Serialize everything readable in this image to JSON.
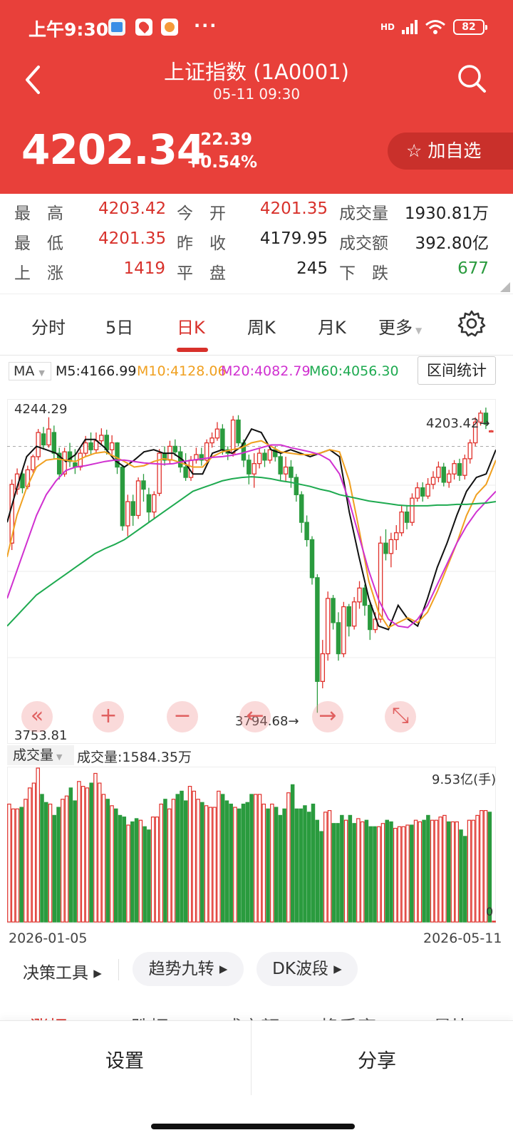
{
  "status": {
    "time": "上午9:30",
    "dots": "···",
    "net": "HD",
    "battery": "82"
  },
  "nav": {
    "title": "上证指数 (1A0001)",
    "subtitle": "05-11 09:30"
  },
  "quote": {
    "price": "4202.34",
    "change": "+22.39",
    "change_pct": "+0.54%",
    "fav_label": "☆ 加自选"
  },
  "stats": [
    {
      "label": "最　高",
      "value": "4203.42"
    },
    {
      "label": "今　开",
      "value": "4201.35"
    },
    {
      "label": "成交量",
      "value": "1930.81万"
    },
    {
      "label": "最　低",
      "value": "4201.35"
    },
    {
      "label": "昨　收",
      "value": "4179.95"
    },
    {
      "label": "成交额",
      "value": "392.80亿"
    },
    {
      "label": "上　涨",
      "value": "1419"
    },
    {
      "label": "平　盘",
      "value": "245"
    },
    {
      "label": "下　跌",
      "value": "677"
    }
  ],
  "tabs": [
    "分时",
    "5日",
    "日K",
    "周K",
    "月K",
    "更多"
  ],
  "ma": {
    "select": "MA",
    "items": [
      {
        "label": "M5:4166.99",
        "color": "#111111"
      },
      {
        "label": "M10:4128.06",
        "color": "#f0a020"
      },
      {
        "label": "M20:4082.79",
        "color": "#d030d0"
      },
      {
        "label": "M60:4056.30",
        "color": "#1eaa50"
      }
    ],
    "range_button": "区间统计"
  },
  "kchart": {
    "y_max_label": "4244.29",
    "y_min_label": "3753.81",
    "high_marker": "4203.42",
    "low_marker": "3794.68",
    "arrow": "→"
  },
  "controls": [
    "«",
    "+",
    "−",
    "←",
    "→",
    "⤡"
  ],
  "volume": {
    "select": "成交量",
    "label": "成交量:1584.35万",
    "max_label": "9.53亿(手)",
    "zero_label": "0"
  },
  "dates": {
    "start": "2026-01-05",
    "end": "2026-05-11"
  },
  "tools": {
    "plain": "决策工具 ▸",
    "pill1": "趋势九转 ▸",
    "pill2": "DK波段 ▸"
  },
  "peek": [
    "涨幅",
    "跌幅",
    "成交额",
    "换手率",
    "量比"
  ],
  "bottom": {
    "settings": "设置",
    "share": "分享"
  },
  "chart_data": {
    "type": "candlestick",
    "ylim": [
      3753.81,
      4244.29
    ],
    "reference_price": 4179.95,
    "candles": [
      {
        "open": 4040,
        "close": 4125,
        "high": 4132,
        "low": 4030
      },
      {
        "open": 4118,
        "close": 4140,
        "high": 4148,
        "low": 4110
      },
      {
        "open": 4140,
        "close": 4120,
        "high": 4146,
        "low": 4112
      },
      {
        "open": 4122,
        "close": 4146,
        "high": 4152,
        "low": 4118
      },
      {
        "open": 4146,
        "close": 4165,
        "high": 4168,
        "low": 4142
      },
      {
        "open": 4165,
        "close": 4200,
        "high": 4205,
        "low": 4160
      },
      {
        "open": 4198,
        "close": 4182,
        "high": 4208,
        "low": 4175
      },
      {
        "open": 4182,
        "close": 4205,
        "high": 4222,
        "low": 4178
      },
      {
        "open": 4200,
        "close": 4170,
        "high": 4210,
        "low": 4162
      },
      {
        "open": 4170,
        "close": 4140,
        "high": 4178,
        "low": 4132
      },
      {
        "open": 4140,
        "close": 4172,
        "high": 4178,
        "low": 4136
      },
      {
        "open": 4172,
        "close": 4158,
        "high": 4185,
        "low": 4150
      },
      {
        "open": 4156,
        "close": 4150,
        "high": 4176,
        "low": 4140
      },
      {
        "open": 4150,
        "close": 4170,
        "high": 4176,
        "low": 4145
      },
      {
        "open": 4170,
        "close": 4185,
        "high": 4195,
        "low": 4165
      },
      {
        "open": 4185,
        "close": 4175,
        "high": 4200,
        "low": 4168
      },
      {
        "open": 4175,
        "close": 4188,
        "high": 4200,
        "low": 4170
      },
      {
        "open": 4188,
        "close": 4196,
        "high": 4206,
        "low": 4182
      },
      {
        "open": 4196,
        "close": 4175,
        "high": 4204,
        "low": 4168
      },
      {
        "open": 4175,
        "close": 4185,
        "high": 4196,
        "low": 4168
      },
      {
        "open": 4185,
        "close": 4150,
        "high": 4186,
        "low": 4140
      },
      {
        "open": 4150,
        "close": 4065,
        "high": 4152,
        "low": 4058
      },
      {
        "open": 4065,
        "close": 4100,
        "high": 4110,
        "low": 4050
      },
      {
        "open": 4100,
        "close": 4080,
        "high": 4110,
        "low": 4065
      },
      {
        "open": 4080,
        "close": 4130,
        "high": 4135,
        "low": 4075
      },
      {
        "open": 4130,
        "close": 4118,
        "high": 4140,
        "low": 4100
      },
      {
        "open": 4110,
        "close": 4085,
        "high": 4120,
        "low": 4070
      },
      {
        "open": 4085,
        "close": 4110,
        "high": 4115,
        "low": 4076
      },
      {
        "open": 4112,
        "close": 4170,
        "high": 4176,
        "low": 4108
      },
      {
        "open": 4170,
        "close": 4160,
        "high": 4180,
        "low": 4152
      },
      {
        "open": 4160,
        "close": 4180,
        "high": 4188,
        "low": 4154
      },
      {
        "open": 4180,
        "close": 4172,
        "high": 4190,
        "low": 4166
      },
      {
        "open": 4172,
        "close": 4150,
        "high": 4180,
        "low": 4142
      },
      {
        "open": 4150,
        "close": 4135,
        "high": 4170,
        "low": 4130
      },
      {
        "open": 4135,
        "close": 4160,
        "high": 4166,
        "low": 4130
      },
      {
        "open": 4160,
        "close": 4168,
        "high": 4178,
        "low": 4155
      },
      {
        "open": 4168,
        "close": 4160,
        "high": 4178,
        "low": 4152
      },
      {
        "open": 4160,
        "close": 4185,
        "high": 4190,
        "low": 4155
      },
      {
        "open": 4185,
        "close": 4192,
        "high": 4200,
        "low": 4178
      },
      {
        "open": 4192,
        "close": 4205,
        "high": 4215,
        "low": 4188
      },
      {
        "open": 4205,
        "close": 4175,
        "high": 4212,
        "low": 4168
      },
      {
        "open": 4175,
        "close": 4170,
        "high": 4180,
        "low": 4160
      },
      {
        "open": 4170,
        "close": 4218,
        "high": 4224,
        "low": 4165
      },
      {
        "open": 4218,
        "close": 4185,
        "high": 4225,
        "low": 4180
      },
      {
        "open": 4185,
        "close": 4160,
        "high": 4190,
        "low": 4150
      },
      {
        "open": 4160,
        "close": 4140,
        "high": 4168,
        "low": 4125
      },
      {
        "open": 4140,
        "close": 4155,
        "high": 4170,
        "low": 4120
      },
      {
        "open": 4155,
        "close": 4170,
        "high": 4178,
        "low": 4148
      },
      {
        "open": 4170,
        "close": 4160,
        "high": 4176,
        "low": 4150
      },
      {
        "open": 4160,
        "close": 4175,
        "high": 4182,
        "low": 4155
      },
      {
        "open": 4175,
        "close": 4165,
        "high": 4180,
        "low": 4158
      },
      {
        "open": 4165,
        "close": 4140,
        "high": 4170,
        "low": 4130
      },
      {
        "open": 4140,
        "close": 4150,
        "high": 4165,
        "low": 4130
      },
      {
        "open": 4150,
        "close": 4135,
        "high": 4160,
        "low": 4120
      },
      {
        "open": 4135,
        "close": 4110,
        "high": 4140,
        "low": 4100
      },
      {
        "open": 4110,
        "close": 4070,
        "high": 4115,
        "low": 4055
      },
      {
        "open": 4070,
        "close": 4045,
        "high": 4080,
        "low": 4035
      },
      {
        "open": 4045,
        "close": 3990,
        "high": 4050,
        "low": 3980
      },
      {
        "open": 3990,
        "close": 3840,
        "high": 3995,
        "low": 3794.68
      },
      {
        "open": 3840,
        "close": 3880,
        "high": 3900,
        "low": 3830
      },
      {
        "open": 3880,
        "close": 3960,
        "high": 3970,
        "low": 3870
      },
      {
        "open": 3960,
        "close": 3925,
        "high": 3965,
        "low": 3915
      },
      {
        "open": 3925,
        "close": 3880,
        "high": 3940,
        "low": 3870
      },
      {
        "open": 3880,
        "close": 3948,
        "high": 3955,
        "low": 3875
      },
      {
        "open": 3948,
        "close": 3920,
        "high": 3952,
        "low": 3905
      },
      {
        "open": 3920,
        "close": 3955,
        "high": 3962,
        "low": 3915
      },
      {
        "open": 3955,
        "close": 3975,
        "high": 3985,
        "low": 3945
      },
      {
        "open": 3975,
        "close": 3950,
        "high": 3980,
        "low": 3935
      },
      {
        "open": 3950,
        "close": 3915,
        "high": 3955,
        "low": 3900
      },
      {
        "open": 3915,
        "close": 3930,
        "high": 3940,
        "low": 3910
      },
      {
        "open": 3930,
        "close": 4040,
        "high": 4050,
        "low": 3925
      },
      {
        "open": 4040,
        "close": 4025,
        "high": 4060,
        "low": 4015
      },
      {
        "open": 4025,
        "close": 4045,
        "high": 4055,
        "low": 4005
      },
      {
        "open": 4045,
        "close": 4055,
        "high": 4066,
        "low": 4030
      },
      {
        "open": 4055,
        "close": 4085,
        "high": 4095,
        "low": 4050
      },
      {
        "open": 4085,
        "close": 4070,
        "high": 4095,
        "low": 4060
      },
      {
        "open": 4070,
        "close": 4105,
        "high": 4112,
        "low": 4065
      },
      {
        "open": 4105,
        "close": 4120,
        "high": 4128,
        "low": 4100
      },
      {
        "open": 4120,
        "close": 4108,
        "high": 4128,
        "low": 4100
      },
      {
        "open": 4108,
        "close": 4125,
        "high": 4134,
        "low": 4104
      },
      {
        "open": 4125,
        "close": 4135,
        "high": 4144,
        "low": 4118
      },
      {
        "open": 4135,
        "close": 4150,
        "high": 4158,
        "low": 4128
      },
      {
        "open": 4150,
        "close": 4128,
        "high": 4156,
        "low": 4122
      },
      {
        "open": 4128,
        "close": 4140,
        "high": 4146,
        "low": 4120
      },
      {
        "open": 4140,
        "close": 4155,
        "high": 4160,
        "low": 4132
      },
      {
        "open": 4155,
        "close": 4138,
        "high": 4162,
        "low": 4130
      },
      {
        "open": 4138,
        "close": 4162,
        "high": 4168,
        "low": 4132
      },
      {
        "open": 4162,
        "close": 4185,
        "high": 4190,
        "low": 4155
      },
      {
        "open": 4185,
        "close": 4215,
        "high": 4222,
        "low": 4180
      },
      {
        "open": 4215,
        "close": 4228,
        "high": 4232,
        "low": 4210
      },
      {
        "open": 4228,
        "close": 4212,
        "high": 4236,
        "low": 4205
      },
      {
        "open": 4201.35,
        "close": 4202.34,
        "high": 4203.42,
        "low": 4201.35
      }
    ],
    "ma_series": [
      {
        "name": "M5",
        "color": "#111111",
        "values": [
          4070,
          4120,
          4165,
          4180,
          4175,
          4170,
          4158,
          4168,
          4190,
          4190,
          4178,
          4160,
          4150,
          4160,
          4172,
          4175,
          4170,
          4170,
          4160,
          4140,
          4140,
          4170,
          4175,
          4170,
          4180,
          4205,
          4200,
          4175,
          4170,
          4175,
          4170,
          4165,
          4170,
          4175,
          4165,
          4085,
          4020,
          3960,
          3920,
          3915,
          3950,
          3930,
          3920,
          3960,
          4005,
          4040,
          4080,
          4115,
          4135,
          4140,
          4175
        ]
      },
      {
        "name": "M10",
        "color": "#f0a020",
        "values": [
          4020,
          4080,
          4120,
          4150,
          4160,
          4162,
          4160,
          4158,
          4165,
          4170,
          4172,
          4165,
          4158,
          4150,
          4152,
          4158,
          4162,
          4160,
          4155,
          4150,
          4150,
          4165,
          4172,
          4175,
          4178,
          4185,
          4188,
          4180,
          4172,
          4170,
          4168,
          4168,
          4170,
          4175,
          4172,
          4130,
          4060,
          3985,
          3940,
          3918,
          3925,
          3932,
          3925,
          3940,
          3970,
          4005,
          4040,
          4080,
          4110,
          4125,
          4160
        ]
      },
      {
        "name": "M20",
        "color": "#d030d0",
        "values": [
          3960,
          4000,
          4040,
          4080,
          4110,
          4130,
          4145,
          4150,
          4152,
          4155,
          4158,
          4160,
          4160,
          4158,
          4156,
          4155,
          4154,
          4155,
          4158,
          4160,
          4162,
          4164,
          4165,
          4167,
          4170,
          4174,
          4178,
          4182,
          4182,
          4178,
          4175,
          4172,
          4168,
          4160,
          4140,
          4100,
          4050,
          4000,
          3958,
          3930,
          3920,
          3918,
          3930,
          3950,
          3980,
          4010,
          4040,
          4065,
          4085,
          4100,
          4115
        ]
      },
      {
        "name": "M60",
        "color": "#1eaa50",
        "values": [
          3920,
          3935,
          3950,
          3965,
          3975,
          3985,
          3995,
          4005,
          4015,
          4025,
          4032,
          4038,
          4045,
          4055,
          4065,
          4075,
          4085,
          4095,
          4105,
          4115,
          4120,
          4125,
          4130,
          4133,
          4135,
          4136,
          4135,
          4133,
          4130,
          4128,
          4125,
          4122,
          4118,
          4115,
          4110,
          4107,
          4104,
          4101,
          4099,
          4097,
          4095,
          4094,
          4094,
          4094,
          4095,
          4095,
          4096,
          4096,
          4097,
          4098,
          4100
        ]
      }
    ],
    "volume_max": 9.53,
    "volume_unit": "亿(手)",
    "volumes": [
      7.3,
      7.0,
      7.0,
      7.1,
      7.6,
      8.3,
      8.6,
      9.53,
      7.9,
      7.4,
      7.3,
      6.6,
      7.1,
      7.6,
      7.8,
      8.3,
      7.5,
      8.7,
      8.4,
      8.3,
      8.6,
      9.2,
      8.6,
      7.9,
      7.6,
      7.2,
      7.0,
      6.6,
      6.5,
      6.0,
      6.2,
      6.4,
      6.3,
      5.9,
      5.7,
      6.5,
      6.5,
      7.3,
      7.6,
      7.0,
      7.6,
      7.9,
      8.1,
      7.5,
      8.4,
      8.1,
      7.6,
      7.4,
      7.2,
      7.1,
      7.1,
      8.1,
      7.9,
      7.5,
      7.3,
      7.1,
      7.0,
      7.3,
      7.4,
      7.9,
      7.9,
      7.9,
      7.3,
      7.0,
      7.3,
      7.1,
      6.6,
      7.0,
      8.0,
      8.5,
      7.0,
      7.0,
      7.2,
      6.8,
      7.3,
      6.3,
      5.6,
      6.8,
      6.9,
      6.1,
      6.1,
      6.6,
      6.3,
      6.6,
      6.1,
      6.4,
      6.2,
      6.3,
      5.9,
      5.9,
      5.9,
      6.1,
      6.3,
      6.2,
      5.8,
      5.9,
      5.9,
      6.0,
      6.0,
      6.3,
      6.2,
      6.3,
      6.6,
      6.3,
      6.3,
      6.5,
      6.6,
      6.2,
      6.2,
      6.2,
      5.7,
      5.3,
      6.3,
      6.3,
      6.6,
      6.9,
      6.9,
      6.8,
      0.05
    ]
  }
}
